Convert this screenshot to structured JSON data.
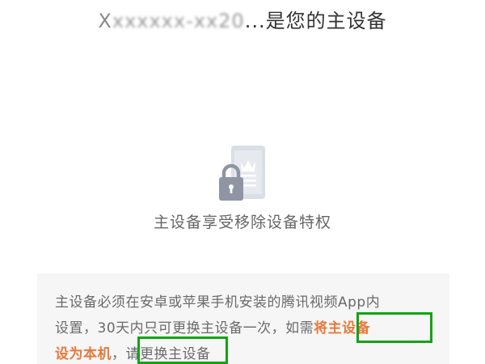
{
  "header": {
    "device_prefix": "X",
    "device_name_blurred": "xxxxxx-xx20",
    "title_suffix": "...是您的主设备"
  },
  "illustration": {
    "icon_name": "main-device-lock-icon",
    "colors": {
      "phone": "#d9dde6",
      "lock": "#8e94a3",
      "crown": "#ffffff"
    }
  },
  "feature": {
    "text": "主设备享受移除设备特权"
  },
  "notice": {
    "line1": "主设备必须在安卓或苹果手机安装的腾讯视频App内",
    "line2_pre": "设置，30天内只可更换主设备一次，如需",
    "highlight_part1": "将主设备",
    "line3_highlight": "设为本机",
    "line3_post": "，请更换主设备",
    "highlight_color": "#e8793a",
    "box_color": "#14a214"
  }
}
